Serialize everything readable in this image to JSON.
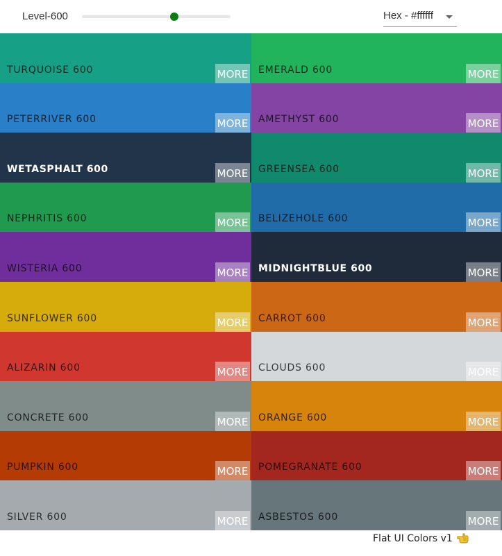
{
  "toolbar": {
    "level_label": "Level-600",
    "level_fraction": 0.62,
    "format_select_value": "Hex - #ffffff"
  },
  "colors": [
    {
      "name": "TURQUOISE 600",
      "hex": "#16a085",
      "more_label": "MORE"
    },
    {
      "name": "EMERALD 600",
      "hex": "#22b35d",
      "more_label": "MORE"
    },
    {
      "name": "PETERRIVER 600",
      "hex": "#2980c8",
      "more_label": "MORE"
    },
    {
      "name": "AMETHYST 600",
      "hex": "#8444a3",
      "more_label": "MORE"
    },
    {
      "name": "WETASPHALT 600",
      "hex": "#21344a",
      "more_label": "MORE",
      "light_text": true
    },
    {
      "name": "GREENSEA 600",
      "hex": "#11896d",
      "more_label": "MORE"
    },
    {
      "name": "NEPHRITIS 600",
      "hex": "#209a4f",
      "more_label": "MORE"
    },
    {
      "name": "BELIZEHOLE 600",
      "hex": "#206ca8",
      "more_label": "MORE"
    },
    {
      "name": "WISTERIA 600",
      "hex": "#6f2e9b",
      "more_label": "MORE"
    },
    {
      "name": "MIDNIGHTBLUE 600",
      "hex": "#1f2a3a",
      "more_label": "MORE",
      "light_text": true
    },
    {
      "name": "SUNFLOWER 600",
      "hex": "#d5ac0b",
      "more_label": "MORE"
    },
    {
      "name": "CARROT 600",
      "hex": "#cc6716",
      "more_label": "MORE"
    },
    {
      "name": "ALIZARIN 600",
      "hex": "#d0382f",
      "more_label": "MORE"
    },
    {
      "name": "CLOUDS 600",
      "hex": "#d4d8da",
      "more_label": "MORE"
    },
    {
      "name": "CONCRETE 600",
      "hex": "#7f8c8a",
      "more_label": "MORE"
    },
    {
      "name": "ORANGE 600",
      "hex": "#d6840c",
      "more_label": "MORE"
    },
    {
      "name": "PUMPKIN 600",
      "hex": "#b53b04",
      "more_label": "MORE"
    },
    {
      "name": "POMEGRANATE 600",
      "hex": "#a3271f",
      "more_label": "MORE"
    },
    {
      "name": "SILVER 600",
      "hex": "#a4aaae",
      "more_label": "MORE"
    },
    {
      "name": "ASBESTOS 600",
      "hex": "#67767a",
      "more_label": "MORE"
    }
  ],
  "footer": {
    "text": "Flat UI Colors v1",
    "icon": "pointing-hand-icon"
  }
}
